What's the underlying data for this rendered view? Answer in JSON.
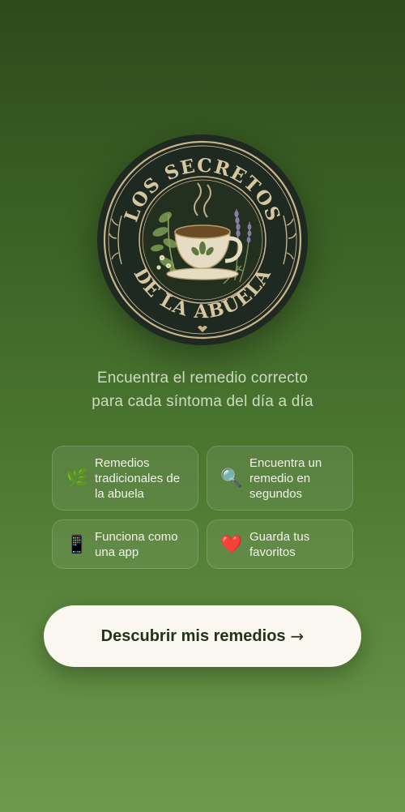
{
  "logo": {
    "top_text": "LOS SECRETOS",
    "bottom_text": "DE LA ABUELA"
  },
  "tagline": {
    "line1": "Encuentra el remedio correcto",
    "line2": "para cada síntoma del día a día"
  },
  "features": [
    {
      "icon": "herb-icon",
      "emoji": "🌿",
      "label": "Remedios tradicionales de la abuela"
    },
    {
      "icon": "magnifier-icon",
      "emoji": "🔍",
      "label": "Encuentra un remedio en segundos"
    },
    {
      "icon": "phone-icon",
      "emoji": "📱",
      "label": "Funciona como una app"
    },
    {
      "icon": "heart-icon",
      "emoji": "❤️",
      "label": "Guarda tus favoritos"
    }
  ],
  "cta": {
    "label": "Descubrir mis remedios",
    "arrow": "→"
  },
  "colors": {
    "background_top": "#2d4a1b",
    "background_bottom": "#6d9a4d",
    "badge_bg": "#1f2a22",
    "badge_gold": "#c9b48a",
    "button_bg": "#faf8f1",
    "button_text": "#22331a"
  }
}
